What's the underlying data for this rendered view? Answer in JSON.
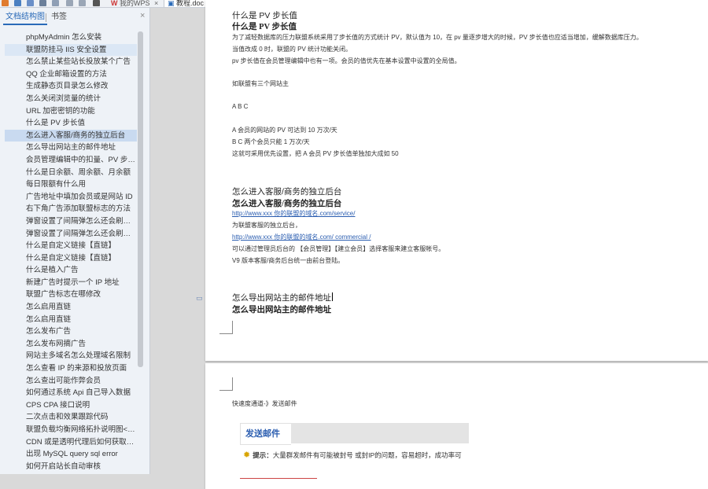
{
  "window": {
    "tabs": [
      {
        "label": "我的WPS",
        "active": false
      },
      {
        "label": "教程.doc",
        "active": true
      }
    ],
    "tab_close_glyph": "×",
    "new_tab_glyph": "+"
  },
  "nav": {
    "tab_outline": "文档结构图",
    "tab_bookmarks": "书签",
    "close_glyph": "×",
    "items": [
      "phpMyAdmin 怎么安装",
      "联盟防挂马 IIS 安全设置",
      "怎么禁止某些站长投放某个广告",
      "QQ 企业邮箱设置的方法",
      "生成静态页目录怎么修改",
      "怎么关闭浏览量的统计",
      "URL 加密密钥的功能",
      "什么是 PV 步长值",
      "怎么进入客服/商务的独立后台",
      "怎么导出网站主的邮件地址",
      "会员管理编辑中的扣量、PV 步值…",
      "什么是日余额、周余额、月余额",
      "每日限额有什么用",
      "广告地址中填加会员或是网站 ID",
      "右下角广告添加联盟标志的方法",
      "弹窗设置了间隔弹怎么还会刷新弹…",
      "弹窗设置了间隔弹怎么还会刷新弹…",
      "什么是自定义链接【直链】",
      "什么是自定义链接【直链】",
      "什么是植入广告",
      "新建广告时提示一个 IP 地址",
      "联盟广告标志在哪修改",
      "怎么启用直链",
      "怎么启用直链",
      "怎么发布广告",
      "怎么发布网摘广告",
      "网站主多域名怎么处理域名限制",
      "怎么查看 IP 的来源和投放页面",
      "怎么查出可能作弊会员",
      "如何通过系统 Api 自己导入数据",
      "CPS CPA 接口说明",
      "二次点击和效果跟踪代码",
      "联盟负载均衡网络拓扑说明图<V…",
      "CDN 或是透明代理后如何获取真…",
      "出现 MySQL query sql error",
      "如何开启站长自动审核"
    ]
  },
  "page1": {
    "top_cut": "什么是 PV 步长值",
    "heading_pv": "什么是 PV 步长值",
    "pv_line1": "为了减轻数据库的压力联盟系统采用了步长值的方式统计 PV，默认值为 10，在 pv 量逐步增大的时候，PV 步长值也应适当增加，缓解数据库压力。",
    "pv_line2": "当值改成 0 时，联盟的 PV 统计功能关闭。",
    "pv_line3": "pv 步长值在会员管理编辑中也有一项。会员的值优先在基本设置中设置的全局值。",
    "example_intro": "如联盟有三个网站主",
    "example_abc": "A B C",
    "example_a": "A 会员的网站的 PV 可达到 10 万次/天",
    "example_bc": "B C 两个会员只能 1 万次/天",
    "example_conclusion": "这就可采用优先设置，把 A 会员 PV 步长值单独加大成如 50",
    "heading_kefu": "怎么进入客服/商务的独立后台",
    "kefu_url1": "http://www.xxx 你的联盟的域名.com/service/",
    "kefu_desc1": "为联盟客服的独立后台，",
    "kefu_url2": "http://www.xxx 你的联盟的域名.com/ commercial /",
    "kefu_desc2": "可以通过管理员后台的 【会员管理】【建立会员】选择客服来建立客服帐号。",
    "kefu_desc3": "V9 版本客服/商务后台统一由前台登陆。",
    "heading_export": "怎么导出网站主的邮件地址"
  },
  "page2": {
    "breadcrumb": "快速度通道-》发送邮件",
    "send_title": "发送邮件",
    "tip_label": "提示：",
    "tip_text": "大量群发邮件有可能被封号 或封IP的问题，容易超时，成功率可"
  },
  "colors": {
    "accent": "#2a6ab8",
    "link": "#2a5db0",
    "page_bg": "#ffffff",
    "workspace_bg": "#d9d9d9"
  }
}
